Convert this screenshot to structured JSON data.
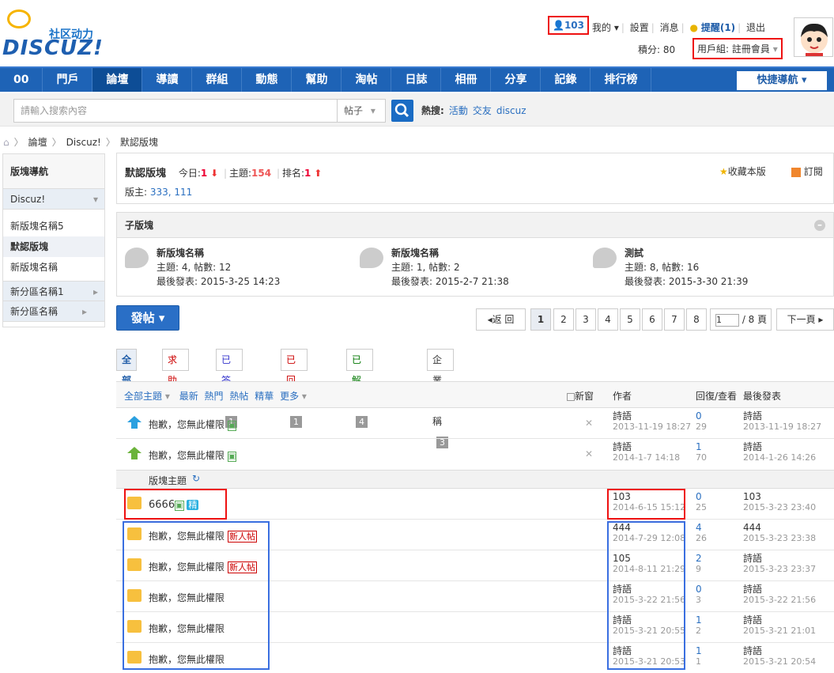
{
  "brand": {
    "sub": "社区动力",
    "main": "DISCUZ!"
  },
  "user": {
    "name": "103",
    "my": "我的",
    "settings": "設置",
    "messages": "消息",
    "reminder": "提醒(1)",
    "logout": "退出",
    "points": "積分: 80",
    "group": "用戶組: 註冊會員"
  },
  "nav": {
    "items": [
      "00",
      "門戶",
      "論壇",
      "導讀",
      "群組",
      "動態",
      "幫助",
      "淘帖",
      "日誌",
      "相冊",
      "分享",
      "記錄",
      "排行榜"
    ],
    "active": 2,
    "quick": "快捷導航 ▾"
  },
  "search": {
    "placeholder": "請輸入搜索內容",
    "type": "帖子",
    "hot_label": "熱搜:",
    "hot": [
      "活動",
      "交友",
      "discuz"
    ]
  },
  "breadcrumb": [
    "論壇",
    "Discuz!",
    "默認版塊"
  ],
  "sidebar": {
    "title": "版塊導航",
    "group": "Discuz!",
    "items": [
      "新版塊名稱5",
      "默認版塊",
      "新版塊名稱"
    ],
    "groups2": [
      "新分區名稱1",
      "新分區名稱"
    ]
  },
  "forum": {
    "name": "默認版塊",
    "today_label": "今日:",
    "today": "1",
    "topics_label": "主題:",
    "topics": "154",
    "rank_label": "排名:",
    "rank": "1",
    "mods_label": "版主:",
    "mods": "333, 111",
    "fav": "收藏本版",
    "rss": "訂閱"
  },
  "subforums": {
    "title": "子版塊",
    "items": [
      {
        "name": "新版塊名稱",
        "stats": "主題: 4, 帖數: 12",
        "last": "最後發表: 2015-3-25 14:23"
      },
      {
        "name": "新版塊名稱",
        "stats": "主題: 1, 帖數: 2",
        "last": "最後發表: 2015-2-7 21:38"
      },
      {
        "name": "測試",
        "stats": "主題: 8, 帖數: 16",
        "last": "最後發表: 2015-3-30 21:39"
      }
    ]
  },
  "post_button": "發帖 ▾",
  "pager": {
    "back": "返 回",
    "pages": [
      "1",
      "2",
      "3",
      "4",
      "5",
      "6",
      "7",
      "8"
    ],
    "current": "1",
    "total": "/ 8 頁",
    "next": "下一頁"
  },
  "filters": [
    {
      "label": "全部",
      "count": ""
    },
    {
      "label": "求助",
      "count": "5"
    },
    {
      "label": "已答覆",
      "count": "1"
    },
    {
      "label": "已回覆",
      "count": "1"
    },
    {
      "label": "已解決",
      "count": "4"
    },
    {
      "label": "企業名稱",
      "count": "3"
    }
  ],
  "thead": {
    "all": "全部主題",
    "latest": "最新",
    "hot": "熱門",
    "hotpost": "熱帖",
    "digest": "精華",
    "more": "更多",
    "newwin": "新窗",
    "author": "作者",
    "replies": "回復/查看",
    "lastpost": "最後發表"
  },
  "section_label": "版塊主題",
  "threads": [
    {
      "title": "抱歉，您無此權限",
      "author": "詩語",
      "adate": "2013-11-19 18:27",
      "rep": "0",
      "views": "29",
      "lp": "詩語",
      "ldate": "2013-11-19 18:27"
    },
    {
      "title": "抱歉，您無此權限",
      "author": "詩語",
      "adate": "2014-1-7 14:18",
      "rep": "1",
      "views": "70",
      "lp": "詩語",
      "ldate": "2014-1-26 14:26"
    },
    {
      "title": "6666",
      "author": "103",
      "adate": "2014-6-15 15:12",
      "rep": "0",
      "views": "25",
      "lp": "103",
      "ldate": "2015-3-23 23:40",
      "digest": "精"
    },
    {
      "title": "抱歉，您無此權限",
      "author": "444",
      "adate": "2014-7-29 12:08",
      "rep": "4",
      "views": "26",
      "lp": "444",
      "ldate": "2015-3-23 23:38",
      "tag": "新人帖"
    },
    {
      "title": "抱歉，您無此權限",
      "author": "105",
      "adate": "2014-8-11 21:29",
      "rep": "2",
      "views": "9",
      "lp": "詩語",
      "ldate": "2015-3-23 23:37",
      "tag": "新人帖"
    },
    {
      "title": "抱歉，您無此權限",
      "author": "詩語",
      "adate": "2015-3-22 21:56",
      "rep": "0",
      "views": "3",
      "lp": "詩語",
      "ldate": "2015-3-22 21:56"
    },
    {
      "title": "抱歉，您無此權限",
      "author": "詩語",
      "adate": "2015-3-21 20:55",
      "rep": "1",
      "views": "2",
      "lp": "詩語",
      "ldate": "2015-3-21 21:01"
    },
    {
      "title": "抱歉，您無此權限",
      "author": "詩語",
      "adate": "2015-3-21 20:53",
      "rep": "1",
      "views": "1",
      "lp": "詩語",
      "ldate": "2015-3-21 20:54"
    }
  ]
}
